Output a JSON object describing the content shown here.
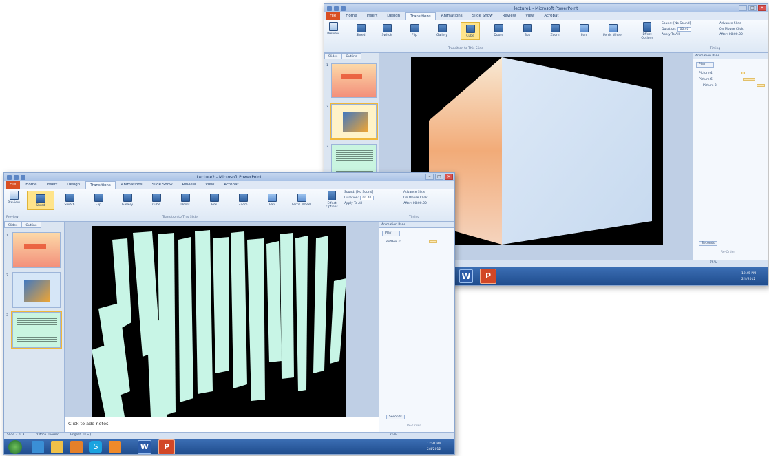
{
  "back_window": {
    "title": "lecture1 - Microsoft PowerPoint",
    "tabs": [
      "File",
      "Home",
      "Insert",
      "Design",
      "Transitions",
      "Animations",
      "Slide Show",
      "Review",
      "View",
      "Acrobat"
    ],
    "active_tab": "Transitions",
    "preview_label": "Preview",
    "transitions": [
      "Shred",
      "Switch",
      "Flip",
      "Gallery",
      "Cube",
      "Doors",
      "Box",
      "Zoom",
      "Pan",
      "Ferris Wheel"
    ],
    "selected_transition": "Cube",
    "effect_options_label": "Effect Options",
    "group_label": "Transition to This Slide",
    "timing": {
      "sound": "Sound: [No Sound]",
      "duration": "Duration:",
      "duration_value": "00.40",
      "apply_to_all": "Apply To All",
      "advance_slide": "Advance Slide",
      "on_mouse_click": "On Mouse Click",
      "after": "After:",
      "after_value": "00:00.00",
      "group": "Timing"
    },
    "pane_tabs": [
      "Slides",
      "Outline"
    ],
    "slide_numbers": [
      "1",
      "2",
      "3"
    ],
    "animation_pane": {
      "title": "Animation Pane",
      "play": "Play",
      "items": [
        "Picture 4",
        "Picture 6",
        "Picture 3"
      ],
      "seconds": "Seconds",
      "reorder": "Re-Order"
    },
    "zoom": "75%",
    "tray_time": "12:45 PM",
    "tray_date": "2/4/2012"
  },
  "front_window": {
    "title": "Lecture2 - Microsoft PowerPoint",
    "tabs": [
      "File",
      "Home",
      "Insert",
      "Design",
      "Transitions",
      "Animations",
      "Slide Show",
      "Review",
      "View",
      "Acrobat"
    ],
    "active_tab": "Transitions",
    "preview_label": "Preview",
    "transitions": [
      "Shred",
      "Switch",
      "Flip",
      "Gallery",
      "Cube",
      "Doors",
      "Box",
      "Zoom",
      "Pan",
      "Ferris Wheel"
    ],
    "selected_transition": "Shred",
    "effect_options_label": "Effect Options",
    "group_label": "Transition to This Slide",
    "preview_group": "Preview",
    "timing": {
      "sound": "Sound: [No Sound]",
      "duration": "Duration:",
      "duration_value": "00.40",
      "apply_to_all": "Apply To All",
      "advance_slide": "Advance Slide",
      "on_mouse_click": "On Mouse Click",
      "after": "After:",
      "after_value": "00:00.00",
      "group": "Timing"
    },
    "pane_tabs": [
      "Slides",
      "Outline"
    ],
    "slide_numbers": [
      "1",
      "2",
      "3"
    ],
    "animation_pane": {
      "title": "Animation Pane",
      "play": "Play",
      "items": [
        "TextBox 3:..."
      ],
      "seconds": "Seconds",
      "reorder": "Re-Order"
    },
    "notes_placeholder": "Click to add notes",
    "status": {
      "slide": "Slide 3 of 3",
      "theme": "\"Office Theme\"",
      "language": "English (U.S.)"
    },
    "zoom": "75%",
    "tray_time": "12:31 PM",
    "tray_date": "2/4/2012"
  },
  "colors": {
    "ribbon_blue": "#dbe5f1",
    "file_tab": "#d94f23",
    "selected": "#ffe48a",
    "shred_strip": "#c8f5e6",
    "taskbar": "#1d4a8a"
  }
}
